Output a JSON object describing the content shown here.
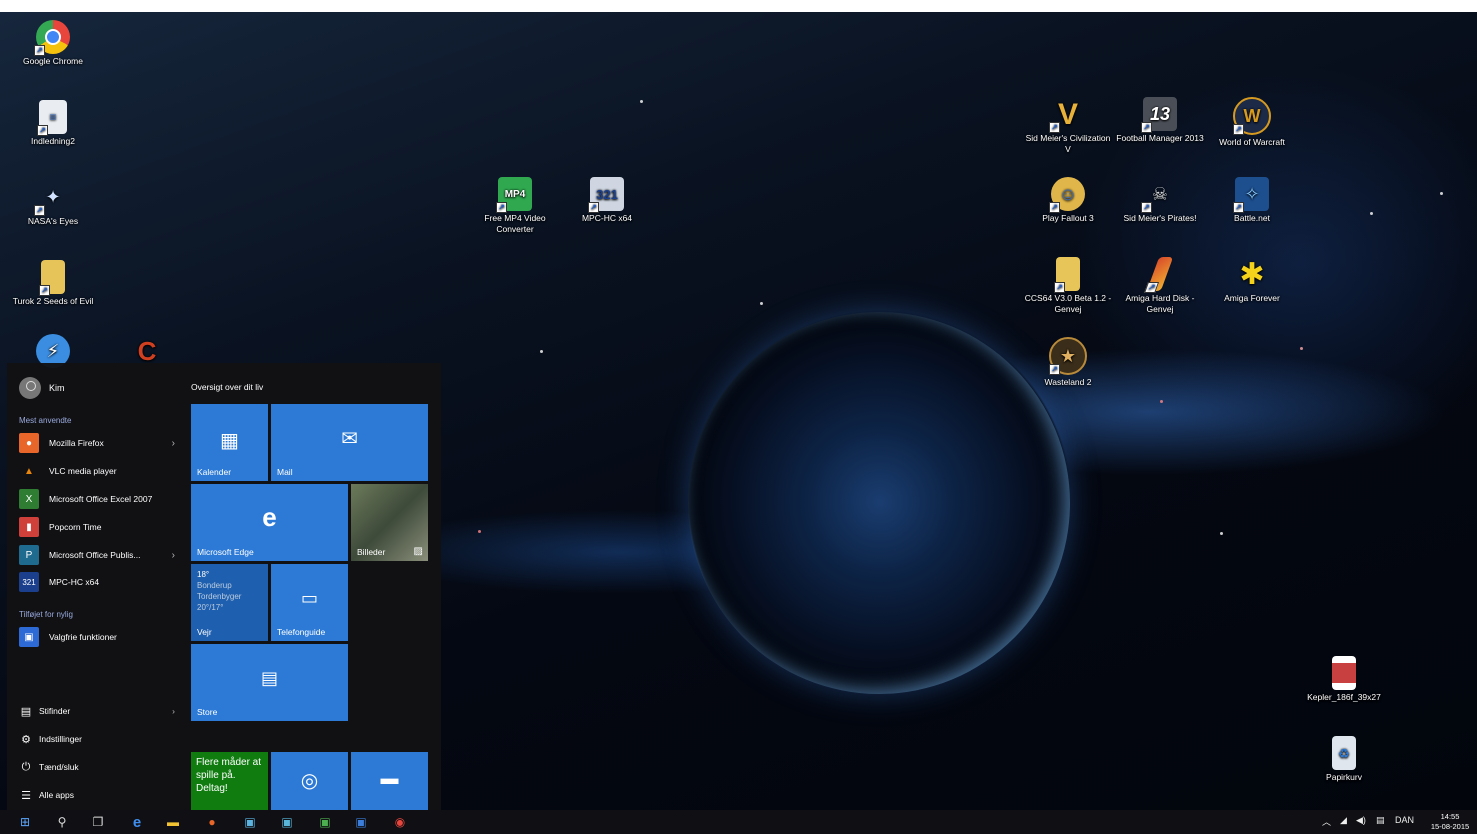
{
  "desktop": {
    "icons": [
      {
        "label": "Google Chrome",
        "icon": "chrome-icon",
        "color": "#e8453c"
      },
      {
        "label": "Indledning2",
        "icon": "document-icon",
        "color": "#e9edf2"
      },
      {
        "label": "NASA's Eyes",
        "icon": "nasa-eyes-icon",
        "color": "#3c6fb5"
      },
      {
        "label": "Turok 2 Seeds of Evil",
        "icon": "folder-shortcut-icon",
        "color": "#e6c45a"
      },
      {
        "label": "",
        "icon": "app-blue-icon",
        "color": "#3a8de0"
      },
      {
        "label": "",
        "icon": "ccleaner-icon",
        "color": "#d04020"
      },
      {
        "label": "Free MP4 Video Converter",
        "icon": "mp4-converter-icon",
        "color": "#2fa84f"
      },
      {
        "label": "MPC-HC x64",
        "icon": "mpc-hc-icon",
        "color": "#cfd6e2"
      },
      {
        "label": "Sid Meier's Civilization V",
        "icon": "civ5-icon",
        "color": "#e8b23a"
      },
      {
        "label": "Football Manager 2013",
        "icon": "football-manager-icon",
        "color": "#4a4f57"
      },
      {
        "label": "World of Warcraft",
        "icon": "wow-icon",
        "color": "#d69a20"
      },
      {
        "label": "Play Fallout 3",
        "icon": "fallout-icon",
        "color": "#e0b64a"
      },
      {
        "label": "Sid Meier's Pirates!",
        "icon": "pirates-icon",
        "color": "#d9dde2"
      },
      {
        "label": "Battle.net",
        "icon": "battlenet-icon",
        "color": "#2d86d6"
      },
      {
        "label": "CCS64 V3.0 Beta 1.2 - Genvej",
        "icon": "folder-door-icon",
        "color": "#e7c558"
      },
      {
        "label": "Amiga Hard Disk - Genvej",
        "icon": "amiga-hd-icon",
        "color": "#d84a2a"
      },
      {
        "label": "Amiga Forever",
        "icon": "amiga-forever-icon",
        "color": "#f4d21c"
      },
      {
        "label": "Wasteland 2",
        "icon": "wasteland-icon",
        "color": "#b88a3a"
      },
      {
        "label": "Kepler_186f_39x27",
        "icon": "image-file-icon",
        "color": "#c94040"
      },
      {
        "label": "Papirkurv",
        "icon": "recycle-bin-icon",
        "color": "#dfe6ee"
      }
    ]
  },
  "start": {
    "user": "Kim",
    "most_used_header": "Mest anvendte",
    "most_used": [
      {
        "label": "Mozilla Firefox",
        "icon": "firefox-icon",
        "color": "#e8662a",
        "chevron": true
      },
      {
        "label": "VLC media player",
        "icon": "vlc-icon",
        "color": "#e8850c",
        "chevron": false
      },
      {
        "label": "Microsoft Office Excel 2007",
        "icon": "excel-icon",
        "color": "#2e7d32",
        "chevron": false
      },
      {
        "label": "Popcorn Time",
        "icon": "popcorn-icon",
        "color": "#d0403a",
        "chevron": false
      },
      {
        "label": "Microsoft Office Publis...",
        "icon": "publisher-icon",
        "color": "#1f6b8f",
        "chevron": true
      },
      {
        "label": "MPC-HC x64",
        "icon": "mpc-hc-icon",
        "color": "#1b3f8c",
        "chevron": false
      }
    ],
    "recent_header": "Tilføjet for nylig",
    "recent": [
      {
        "label": "Valgfrie funktioner",
        "icon": "features-icon",
        "color": "#2d6ad6"
      }
    ],
    "bottom": [
      {
        "label": "Stifinder",
        "icon": "file-explorer-icon",
        "glyph": "▤",
        "chevron": true
      },
      {
        "label": "Indstillinger",
        "icon": "settings-gear-icon",
        "glyph": "⚙",
        "chevron": false
      },
      {
        "label": "Tænd/sluk",
        "icon": "power-icon",
        "glyph": "⏻",
        "chevron": false
      },
      {
        "label": "Alle apps",
        "icon": "all-apps-icon",
        "glyph": "☰",
        "chevron": false
      }
    ],
    "tiles_header": "Oversigt over dit liv",
    "tiles": {
      "calendar": "Kalender",
      "mail": "Mail",
      "edge": "Microsoft Edge",
      "photos": "Billeder",
      "weather": {
        "temp": "18°",
        "city": "Bonderup",
        "cond": "Tordenbyger",
        "range": "20°/17°",
        "label": "Vejr"
      },
      "phone": "Telefonguide",
      "store": "Store",
      "xbox": "Flere måder at spille på. Deltag!"
    }
  },
  "taskbar": {
    "items": [
      "windows-start-icon",
      "search-icon",
      "task-view-icon",
      "edge-icon",
      "file-explorer-icon",
      "firefox-icon",
      "publisher-icon",
      "publisher-alt-icon",
      "excel-icon",
      "app-icon",
      "chrome-icon"
    ],
    "tray": {
      "lang": "DAN",
      "time": "14:55",
      "date": "15-08-2015"
    }
  }
}
